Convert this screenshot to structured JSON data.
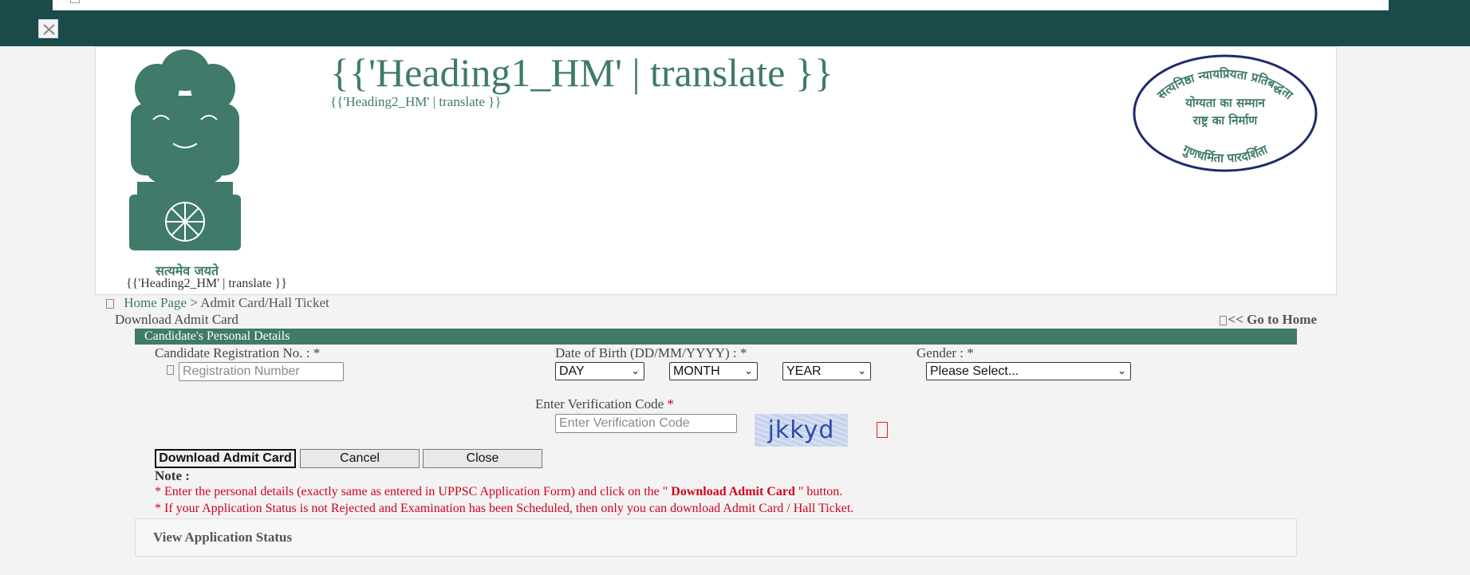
{
  "header": {
    "heading1": "{{'Heading1_HM' | translate }}",
    "heading2": "{{'Heading2_HM' | translate }}",
    "emblem_motto": "सत्यमेव जयते",
    "emblem_caption": "{{'Heading2_HM' | translate }}",
    "seal_text_top": "सत्यनिष्ठा न्यायप्रियता प्रतिबद्धता",
    "seal_text_mid1": "योग्यता का सम्मान",
    "seal_text_mid2": "राष्ट्र का निर्माण",
    "seal_text_bottom": "गुणधर्मिता पारदर्शिता"
  },
  "breadcrumb": {
    "home": "Home Page",
    "separator": " > ",
    "current": "Admit Card/Hall Ticket"
  },
  "page": {
    "subtitle": "Download Admit Card",
    "go_home": "<< Go to Home"
  },
  "section": {
    "title": "Candidate's Personal Details"
  },
  "form": {
    "reg_label": "Candidate Registration No. : *",
    "reg_placeholder": "Registration Number",
    "dob_label": "Date of Birth (DD/MM/YYYY) : *",
    "day_value": "DAY",
    "month_value": "MONTH",
    "year_value": "YEAR",
    "gender_label": "Gender : *",
    "gender_value": "Please Select...",
    "verify_label": "Enter Verification Code",
    "verify_required": "*",
    "verify_placeholder": "Enter Verification Code",
    "captcha_text": "jkkyd"
  },
  "buttons": {
    "download": "Download Admit Card",
    "cancel": "Cancel",
    "close": "Close"
  },
  "note": {
    "title": "Note :",
    "line1_pre": "* Enter the personal details (exactly same as entered in UPPSC Application Form) and click on the \" ",
    "line1_bold": "Download Admit Card",
    "line1_post": " \" button.",
    "line2": "* If your Application Status is not Rejected and Examination has been Scheduled, then only you can download Admit Card / Hall Ticket."
  },
  "status_panel": {
    "label": "View Application Status"
  },
  "colors": {
    "topbar": "#1b4a4a",
    "accent": "#3f7a6a",
    "note_red": "#d0021b",
    "seal_border": "#1f2a6b"
  }
}
